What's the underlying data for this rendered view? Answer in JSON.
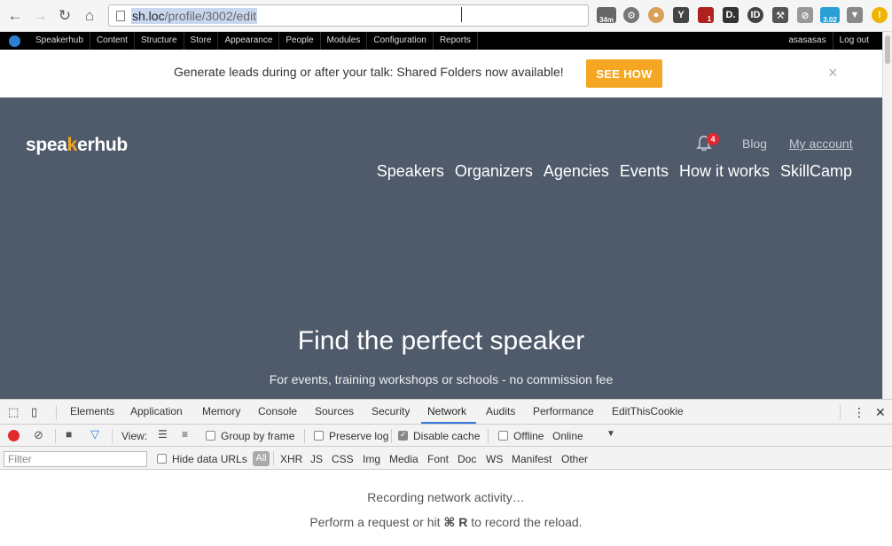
{
  "browser": {
    "url_host": "sh.loc",
    "url_path": "/profile/3002/edit",
    "ext_badge_34m": "34m",
    "ext_badge_302": "3.02",
    "ext_badge_1": "1"
  },
  "admin_bar": {
    "items": [
      "Speakerhub",
      "Content",
      "Structure",
      "Store",
      "Appearance",
      "People",
      "Modules",
      "Configuration",
      "Reports"
    ],
    "user": "asasasas",
    "logout": "Log out"
  },
  "promo": {
    "text": "Generate leads during or after your talk: Shared Folders now available!",
    "button": "SEE HOW",
    "close": "×"
  },
  "site": {
    "logo_pre": "spea",
    "logo_mark": "k",
    "logo_post": "erhub",
    "notifications": "4",
    "blog": "Blog",
    "account": "My account",
    "nav": [
      "Speakers",
      "Organizers",
      "Agencies",
      "Events",
      "How it works",
      "SkillCamp"
    ],
    "hero_title": "Find the perfect speaker",
    "hero_subtitle": "For events, training workshops or schools - no commission fee"
  },
  "devtools": {
    "tabs": [
      "Elements",
      "Application",
      "Memory",
      "Console",
      "Sources",
      "Security",
      "Network",
      "Audits",
      "Performance",
      "EditThisCookie"
    ],
    "active_tab": "Network",
    "view_label": "View:",
    "group_by_frame": "Group by frame",
    "preserve_log": "Preserve log",
    "disable_cache": "Disable cache",
    "offline": "Offline",
    "throttle": "Online",
    "filter_placeholder": "Filter",
    "hide_data_urls": "Hide data URLs",
    "all": "All",
    "types": [
      "XHR",
      "JS",
      "CSS",
      "Img",
      "Media",
      "Font",
      "Doc",
      "WS",
      "Manifest",
      "Other"
    ],
    "recording": "Recording network activity…",
    "hint_pre": "Perform a request or hit ",
    "hint_key": "⌘ R",
    "hint_post": " to record the reload."
  }
}
